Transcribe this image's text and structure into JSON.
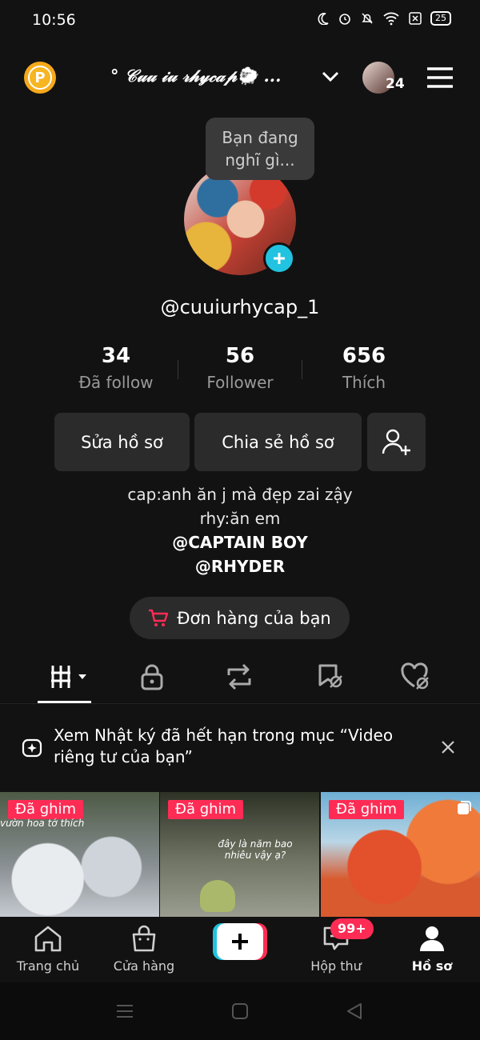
{
  "status_bar": {
    "time": "10:56",
    "battery": "25"
  },
  "header": {
    "coin_label": "P",
    "username": "° 𝒞𝓊𝓊 𝒾𝓊 𝓇𝒽𝓎𝒸𝒶𝓅🐑 ...",
    "friends_count": "24"
  },
  "profile": {
    "bubble_line1": "Bạn đang",
    "bubble_line2": "nghĩ gì...",
    "handle": "@cuuiurhycap_1",
    "stats": [
      {
        "value": "34",
        "label": "Đã follow"
      },
      {
        "value": "56",
        "label": "Follower"
      },
      {
        "value": "656",
        "label": "Thích"
      }
    ],
    "edit_button": "Sửa hồ sơ",
    "share_button": "Chia sẻ hồ sơ",
    "bio": [
      "cap:anh ăn j mà đẹp zai zậy",
      "rhy:ăn em",
      "@CAPTAIN BOY",
      "@RHYDER"
    ],
    "orders_button": "Đơn hàng của bạn"
  },
  "banner": {
    "text": "Xem Nhật ký đã hết hạn trong mục “Video riêng tư của bạn”"
  },
  "videos": [
    {
      "pin": "Đã ghim",
      "caption": "vườn hoa tớ thích"
    },
    {
      "pin": "Đã ghim",
      "caption": "đây là năm bao nhiêu vậy ạ?"
    },
    {
      "pin": "Đã ghim",
      "caption": ""
    }
  ],
  "bottom_nav": {
    "items": [
      {
        "label": "Trang chủ"
      },
      {
        "label": "Cửa hàng"
      },
      {
        "label": "Hộp thư"
      },
      {
        "label": "Hồ sơ"
      }
    ],
    "inbox_badge": "99+"
  },
  "colors": {
    "accent_pink": "#FE2C55",
    "accent_cyan": "#21C3E0",
    "coin": "#F5A91B",
    "background": "#121212"
  }
}
